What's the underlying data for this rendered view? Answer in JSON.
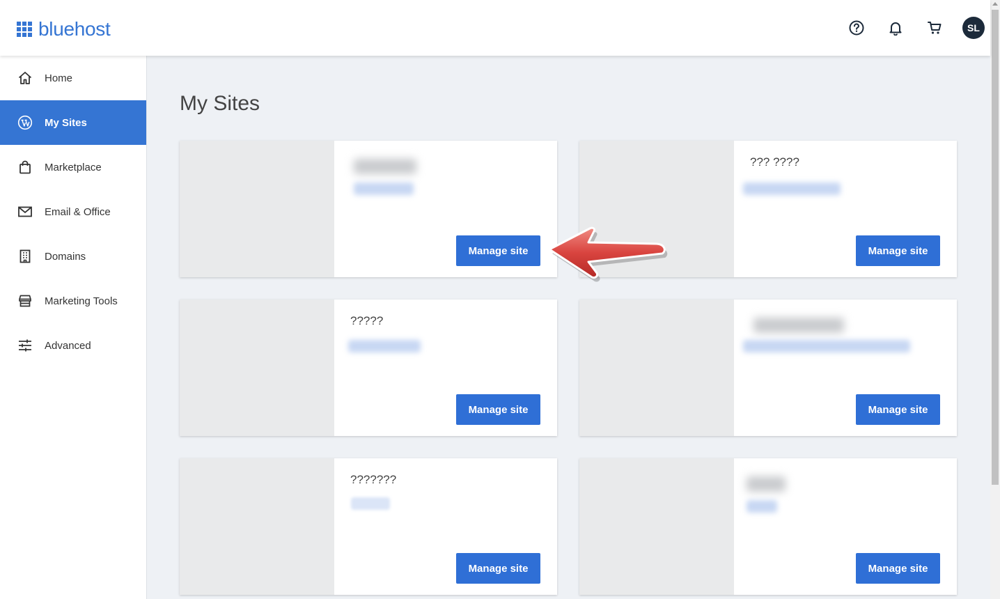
{
  "header": {
    "brand": "bluehost",
    "icons": [
      "help-icon",
      "bell-icon",
      "cart-icon"
    ],
    "avatar_initials": "SL"
  },
  "sidebar": {
    "items": [
      {
        "label": "Home",
        "icon": "home-icon",
        "active": false
      },
      {
        "label": "My Sites",
        "icon": "wordpress-icon",
        "active": true
      },
      {
        "label": "Marketplace",
        "icon": "shopping-bag-icon",
        "active": false
      },
      {
        "label": "Email & Office",
        "icon": "envelope-icon",
        "active": false
      },
      {
        "label": "Domains",
        "icon": "building-icon",
        "active": false
      },
      {
        "label": "Marketing Tools",
        "icon": "storefront-icon",
        "active": false
      },
      {
        "label": "Advanced",
        "icon": "sliders-icon",
        "active": false
      }
    ]
  },
  "main": {
    "title": "My Sites",
    "sites": [
      {
        "name": "",
        "button": "Manage site"
      },
      {
        "name": "??? ????",
        "button": "Manage site"
      },
      {
        "name": "?????",
        "button": "Manage site"
      },
      {
        "name": "",
        "button": "Manage site"
      },
      {
        "name": "???????",
        "button": "Manage site"
      },
      {
        "name": "",
        "button": "Manage site"
      }
    ]
  },
  "colors": {
    "accent": "#3575d3",
    "button": "#2f6fd6",
    "avatar_bg": "#1c2a3a",
    "arrow": "#d9443f"
  }
}
